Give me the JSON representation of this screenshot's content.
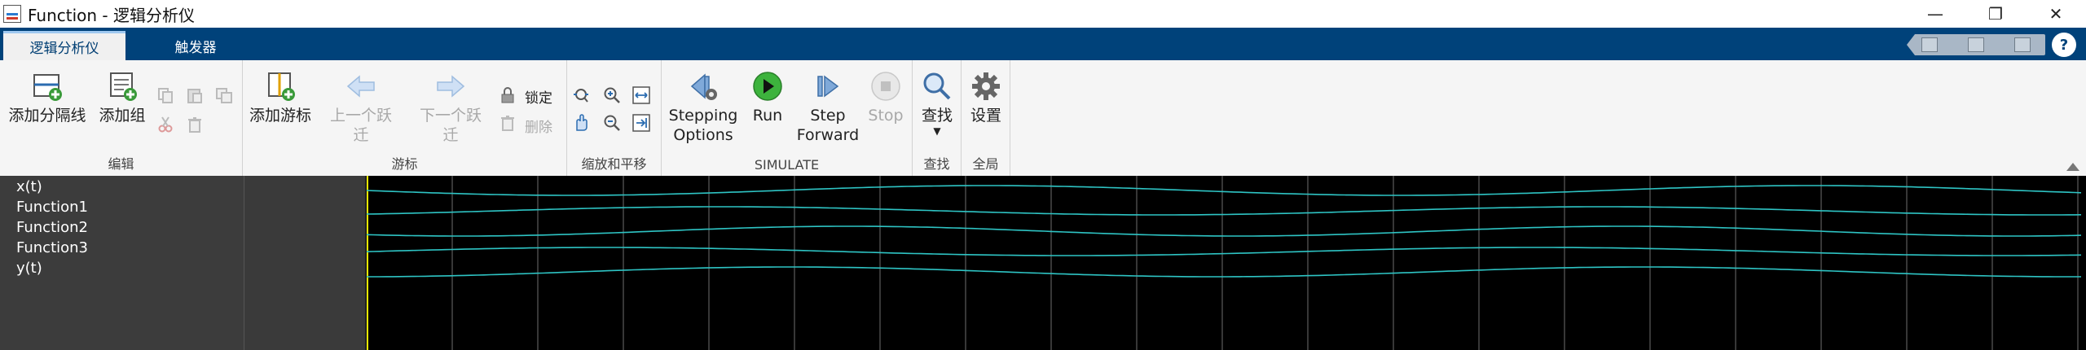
{
  "window": {
    "title": "Function - 逻辑分析仪"
  },
  "tabs": [
    {
      "label": "逻辑分析仪",
      "active": true
    },
    {
      "label": "触发器",
      "active": false
    }
  ],
  "ribbon": {
    "edit": {
      "label": "编辑",
      "add_divider": "添加分隔线",
      "add_group": "添加组"
    },
    "cursor": {
      "label": "游标",
      "add_cursor": "添加游标",
      "prev_transition": "上一个跃迁",
      "next_transition": "下一个跃迁",
      "lock": "锁定",
      "delete": "删除"
    },
    "zoom": {
      "label": "缩放和平移"
    },
    "simulate": {
      "label": "SIMULATE",
      "stepping_line1": "Stepping",
      "stepping_line2": "Options",
      "run": "Run",
      "step_line1": "Step",
      "step_line2": "Forward",
      "stop": "Stop"
    },
    "find": {
      "label": "查找",
      "find": "查找"
    },
    "global": {
      "label": "全局",
      "settings": "设置"
    }
  },
  "signals": [
    "x(t)",
    "Function1",
    "Function2",
    "Function3",
    "y(t)"
  ],
  "colors": {
    "accent": "#00427a",
    "wave": "#2ec4c4",
    "grid": "#6e6e6e",
    "cursor": "#e6e600"
  }
}
